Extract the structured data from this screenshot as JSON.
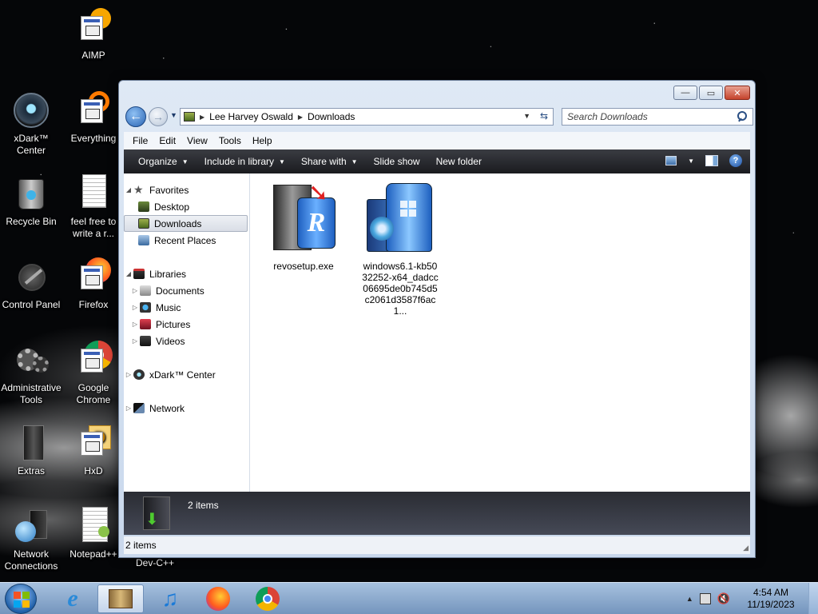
{
  "desktop": {
    "icons": [
      {
        "label": "AIMP"
      },
      {
        "label": "xDark™ Center"
      },
      {
        "label": "Everything"
      },
      {
        "label": "Recycle Bin"
      },
      {
        "label": "feel free to write a r..."
      },
      {
        "label": "Control Panel"
      },
      {
        "label": "Firefox"
      },
      {
        "label": "Administrative Tools"
      },
      {
        "label": "Google Chrome"
      },
      {
        "label": "Extras"
      },
      {
        "label": "HxD"
      },
      {
        "label": "Network Connections"
      },
      {
        "label": "Notepad++"
      },
      {
        "label": "Dev-C++"
      }
    ]
  },
  "window": {
    "address": {
      "segments": [
        "Lee Harvey Oswald",
        "Downloads"
      ]
    },
    "search": {
      "placeholder": "Search Downloads"
    },
    "menu": [
      "File",
      "Edit",
      "View",
      "Tools",
      "Help"
    ],
    "toolbar": {
      "organize": "Organize",
      "include": "Include in library",
      "share": "Share with",
      "slideshow": "Slide show",
      "newfolder": "New folder"
    },
    "nav": {
      "favorites": "Favorites",
      "desktop": "Desktop",
      "downloads": "Downloads",
      "recent": "Recent Places",
      "libraries": "Libraries",
      "documents": "Documents",
      "music": "Music",
      "pictures": "Pictures",
      "videos": "Videos",
      "xdark": "xDark™ Center",
      "network": "Network"
    },
    "files": [
      {
        "name": "revosetup.exe"
      },
      {
        "name": "windows6.1-kb5032252-x64_dadcc06695de0b745d5c2061d3587f6ac1..."
      }
    ],
    "details": {
      "count": "2 items"
    },
    "status": {
      "count": "2 items"
    }
  },
  "taskbar": {
    "clock": {
      "time": "4:54 AM",
      "date": "11/19/2023"
    }
  },
  "colors": {
    "toolbar_bg": "#1a1b1f",
    "selection_bg": "#d9dee6",
    "taskbar": "#7495bd"
  }
}
